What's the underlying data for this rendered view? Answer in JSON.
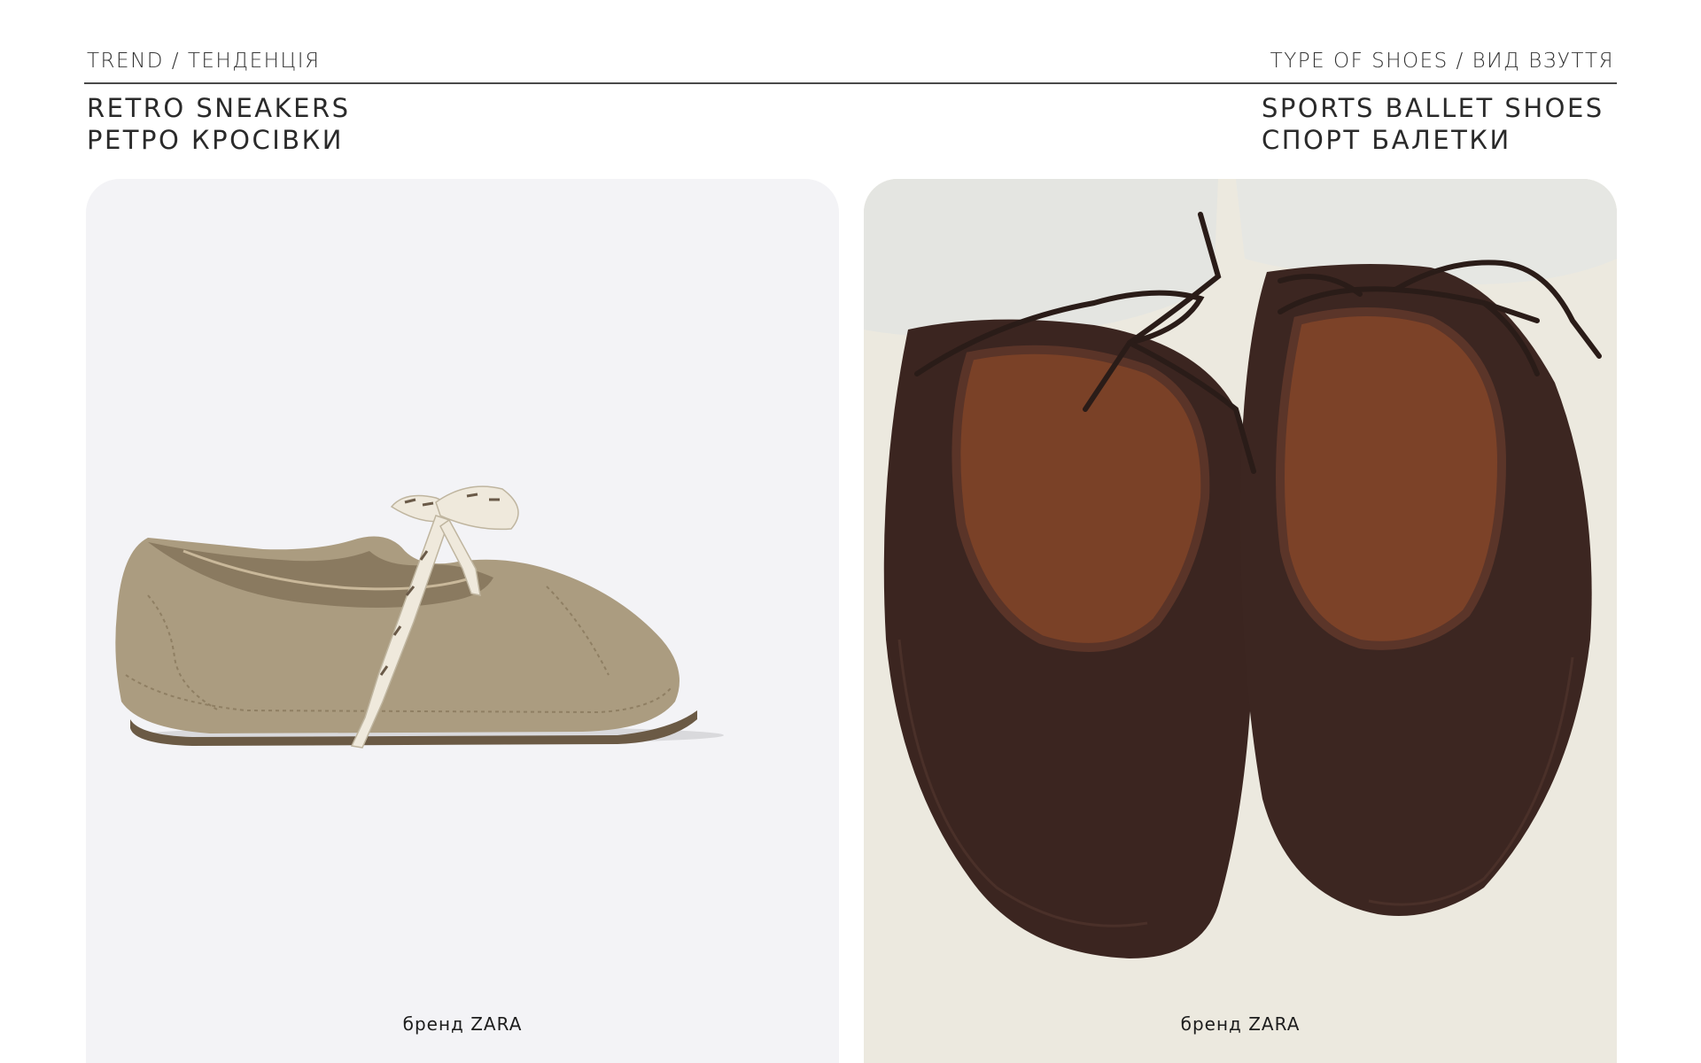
{
  "header": {
    "left_eyebrow": "TREND / ТЕНДЕНЦІЯ",
    "right_eyebrow": "TYPE OF SHOES / ВИД ВЗУТТЯ"
  },
  "left": {
    "title_en": "RETRO SNEAKERS",
    "title_ua": "РЕТРО КРОСІВКИ",
    "caption": "бренд ZARA"
  },
  "right": {
    "title_en": "SPORTS BALLET SHOES",
    "title_ua": "СПОРТ БАЛЕТКИ",
    "caption": "бренд ZARA"
  },
  "colors": {
    "suede_shoe": "#a99a80",
    "satin_shoe": "#3b2520",
    "lace_cream": "#efe9dc",
    "trouser": "#e8e8e4"
  }
}
